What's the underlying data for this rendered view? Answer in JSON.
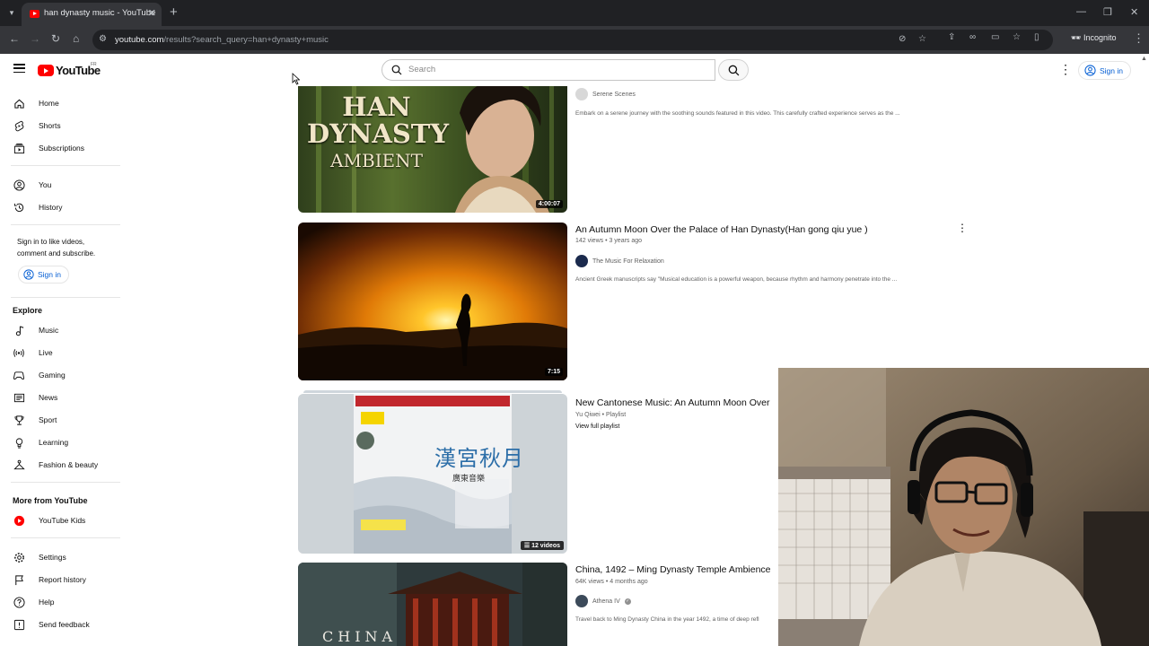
{
  "browser": {
    "tab_title": "han dynasty music - YouTube",
    "url_host": "youtube.com",
    "url_path": "/results?search_query=han+dynasty+music",
    "incognito_label": "Incognito"
  },
  "header": {
    "logo_text": "YouTube",
    "logo_country": "FR",
    "search_placeholder": "Search",
    "signin_label": "Sign in"
  },
  "sidebar": {
    "main": [
      {
        "label": "Home",
        "icon": "home-icon"
      },
      {
        "label": "Shorts",
        "icon": "shorts-icon"
      },
      {
        "label": "Subscriptions",
        "icon": "subscriptions-icon"
      }
    ],
    "you": [
      {
        "label": "You",
        "icon": "you-icon"
      },
      {
        "label": "History",
        "icon": "history-icon"
      }
    ],
    "signin_prompt": "Sign in to like videos, comment and subscribe.",
    "signin_button": "Sign in",
    "explore_heading": "Explore",
    "explore": [
      {
        "label": "Music",
        "icon": "music-icon"
      },
      {
        "label": "Live",
        "icon": "live-icon"
      },
      {
        "label": "Gaming",
        "icon": "gaming-icon"
      },
      {
        "label": "News",
        "icon": "news-icon"
      },
      {
        "label": "Sport",
        "icon": "sport-icon"
      },
      {
        "label": "Learning",
        "icon": "learning-icon"
      },
      {
        "label": "Fashion & beauty",
        "icon": "fashion-icon"
      }
    ],
    "more_heading": "More from YouTube",
    "more": [
      {
        "label": "YouTube Kids",
        "icon": "youtube-kids-icon"
      }
    ],
    "footer": [
      {
        "label": "Settings",
        "icon": "settings-icon"
      },
      {
        "label": "Report history",
        "icon": "flag-icon"
      },
      {
        "label": "Help",
        "icon": "help-icon"
      },
      {
        "label": "Send feedback",
        "icon": "feedback-icon"
      }
    ]
  },
  "results": [
    {
      "thumb_text_1": "HAN",
      "thumb_text_2": "DYNASTY",
      "thumb_text_3": "AMBIENT",
      "duration": "4:00:07",
      "channel": "Serene Scenes",
      "description": "Embark on a serene journey with the soothing sounds featured in this video. This carefully crafted experience serves as the ..."
    },
    {
      "title": "An Autumn Moon Over the Palace of Han Dynasty(Han gong qiu yue )",
      "meta": "142 views • 3 years ago",
      "channel": "The Music For Relaxation",
      "description": "Ancient Greek manuscripts say \"Musical education is a powerful weapon, because rhythm and harmony penetrate into the ...",
      "duration": "7:15"
    },
    {
      "title": "New Cantonese Music: An Autumn Moon Over",
      "meta": "Yu Qiwei • Playlist",
      "link": "View full playlist",
      "badge": "12 videos"
    },
    {
      "title": "China, 1492 – Ming Dynasty Temple Ambience",
      "meta": "64K views • 4 months ago",
      "channel": "Athena IV",
      "description": "Travel back to Ming Dynasty China in the year 1492, a time of deep refl",
      "thumb_text": "CHINA"
    }
  ],
  "colors": {
    "brand_red": "#ff0000",
    "link_blue": "#065fd4",
    "chrome_dark": "#202124"
  }
}
